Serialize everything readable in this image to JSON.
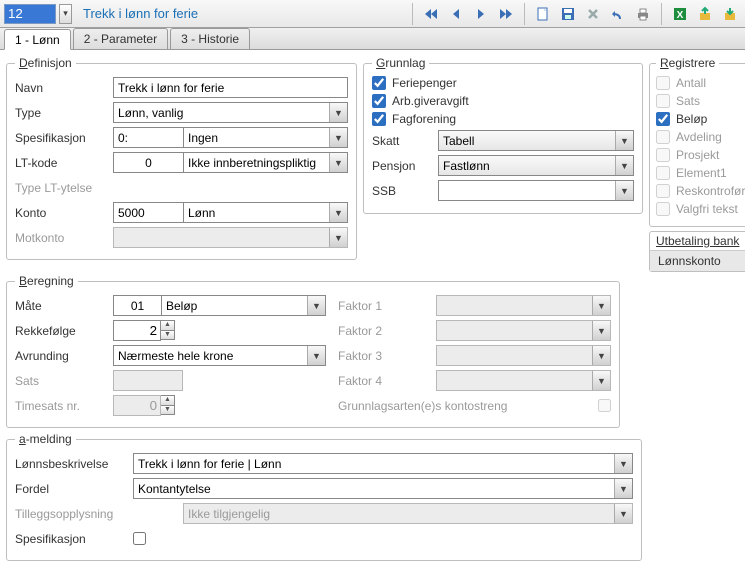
{
  "toolbar": {
    "code": "12",
    "title": "Trekk i lønn for ferie"
  },
  "tabs": [
    "1 - Lønn",
    "2 - Parameter",
    "3 - Historie"
  ],
  "defin": {
    "legend_pre": "D",
    "legend_rest": "efinisjon",
    "navn_lbl": "Navn",
    "navn": "Trekk i lønn for ferie",
    "type_lbl": "Type",
    "type_code": "",
    "type_text": "Lønn, vanlig",
    "spes_lbl": "Spesifikasjon",
    "spes_code": "0:",
    "spes_text": "Ingen",
    "lt_lbl": "LT-kode",
    "lt_code": "0",
    "lt_text": "Ikke innberetningspliktig",
    "typelt_lbl": "Type LT-ytelse",
    "konto_lbl": "Konto",
    "konto_code": "5000",
    "konto_text": "Lønn",
    "motkonto_lbl": "Motkonto"
  },
  "grunn": {
    "legend_pre": "G",
    "legend_rest": "runnlag",
    "ferie": "Feriepenger",
    "arb": "Arb.giveravgift",
    "fag": "Fagforening",
    "skatt_lbl": "Skatt",
    "skatt": "Tabell",
    "pensjon_lbl": "Pensjon",
    "pensjon": "Fastlønn",
    "ssb_lbl": "SSB",
    "ssb": ""
  },
  "reg": {
    "legend_pre": "R",
    "legend_rest": "egistrere",
    "antall": "Antall",
    "sats": "Sats",
    "belop": "Beløp",
    "avdeling": "Avdeling",
    "prosjekt": "Prosjekt",
    "element1": "Element1",
    "reskontro": "Reskontroføres",
    "valgfri": "Valgfri tekst"
  },
  "utb": {
    "hdr": "Utbetaling bank",
    "item": "Lønnskonto"
  },
  "bereg": {
    "legend_pre": "B",
    "legend_rest": "eregning",
    "mate_lbl": "Måte",
    "mate_code": "01",
    "mate_text": "Beløp",
    "rekke_lbl": "Rekkefølge",
    "rekke": "2",
    "avr_lbl": "Avrunding",
    "avr": "Nærmeste hele krone",
    "sats_lbl": "Sats",
    "time_lbl": "Timesats nr.",
    "time": "0",
    "f1": "Faktor 1",
    "f2": "Faktor 2",
    "f3": "Faktor 3",
    "f4": "Faktor 4",
    "gk": "Grunnlagsarten(e)s kontostreng"
  },
  "am": {
    "legend_pre": "a",
    "legend_rest": "-melding",
    "lb_lbl": "Lønnsbeskrivelse",
    "lb": "Trekk i lønn for ferie | Lønn",
    "fordel_lbl": "Fordel",
    "fordel": "Kontantytelse",
    "till_lbl": "Tilleggsopplysning",
    "till": "Ikke tilgjengelig",
    "spes_lbl": "Spesifikasjon"
  }
}
